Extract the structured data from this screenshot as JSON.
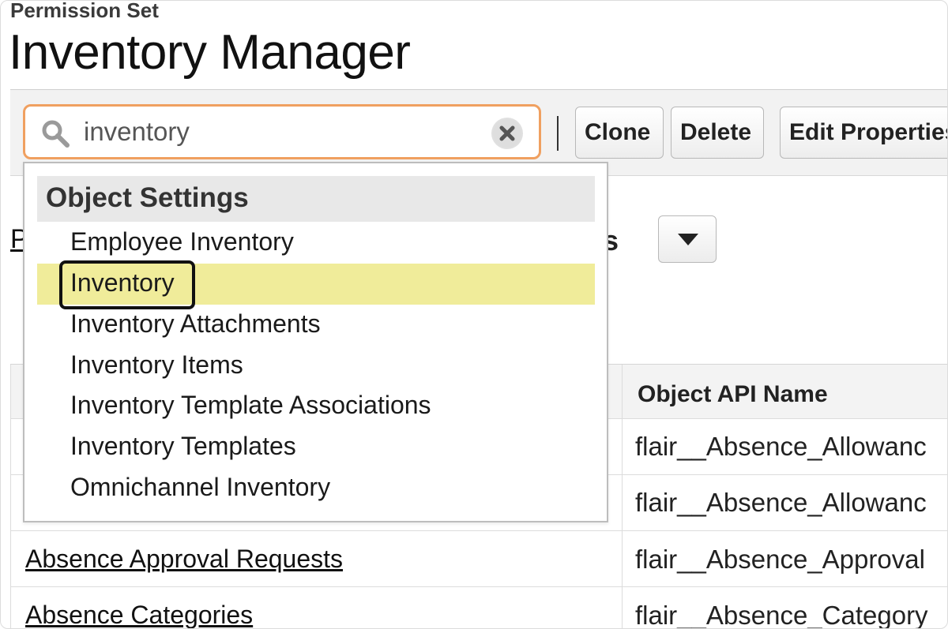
{
  "header": {
    "eyebrow": "Permission Set",
    "title": "Inventory Manager"
  },
  "search": {
    "value": "inventory",
    "icon": "search-icon",
    "clear_icon": "clear-icon"
  },
  "toolbar": {
    "clone_label": "Clone",
    "delete_label": "Delete",
    "edit_label": "Edit Properties"
  },
  "section": {
    "left_fragment": "P",
    "right_fragment": "gs",
    "dropdown_icon": "caret-down-icon"
  },
  "table": {
    "header_right": "Object API Name",
    "rows": [
      {
        "label": "",
        "api": "flair__Absence_Allowanc"
      },
      {
        "label": "",
        "api": "flair__Absence_Allowanc"
      },
      {
        "label": "Absence Approval Requests",
        "api": "flair__Absence_Approval"
      },
      {
        "label": "Absence Categories",
        "api": "flair__Absence_Category"
      }
    ]
  },
  "dropdown": {
    "header": "Object Settings",
    "items": [
      {
        "label": "Employee Inventory",
        "highlighted": false
      },
      {
        "label": "Inventory",
        "highlighted": true
      },
      {
        "label": "Inventory Attachments",
        "highlighted": false
      },
      {
        "label": "Inventory Items",
        "highlighted": false
      },
      {
        "label": "Inventory Template Associations",
        "highlighted": false
      },
      {
        "label": "Inventory Templates",
        "highlighted": false
      },
      {
        "label": "Omnichannel Inventory",
        "highlighted": false
      }
    ]
  },
  "colors": {
    "search_border": "#f0a060",
    "highlight": "#f0ec9a"
  }
}
